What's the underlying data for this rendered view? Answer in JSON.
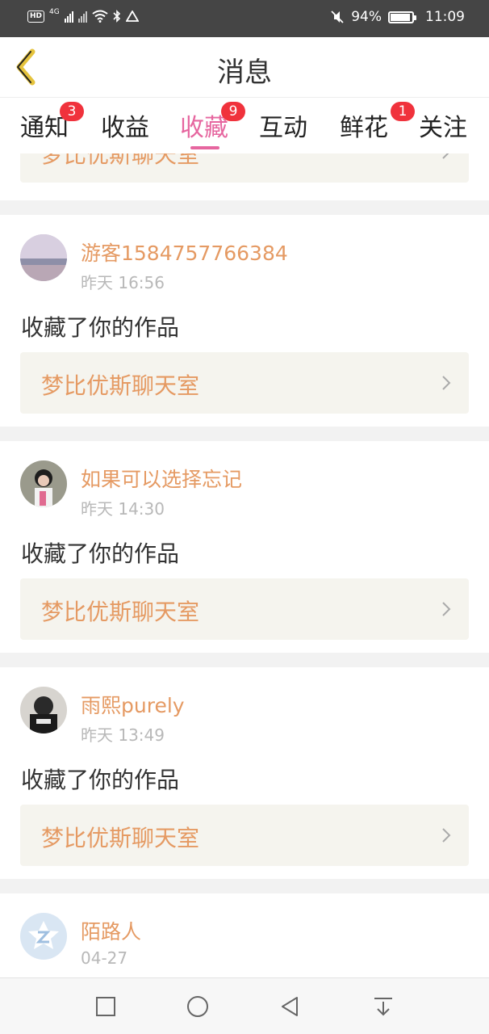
{
  "status_bar": {
    "network": "4G",
    "hd": "HD",
    "battery_percent": "94%",
    "battery_level": 0.94,
    "time": "11:09"
  },
  "header": {
    "title": "消息",
    "back_icon": "back-chevron-icon"
  },
  "tabs": [
    {
      "label": "通知",
      "badge": "3",
      "active": false
    },
    {
      "label": "收益",
      "badge": "",
      "active": false
    },
    {
      "label": "收藏",
      "badge": "9",
      "active": true
    },
    {
      "label": "互动",
      "badge": "",
      "active": false
    },
    {
      "label": "鲜花",
      "badge": "1",
      "active": false
    },
    {
      "label": "关注",
      "badge": "",
      "active": false
    }
  ],
  "feed": {
    "partial_top_work_title": "梦比优斯聊天室",
    "items": [
      {
        "user": "游客1584757766384",
        "time": "昨天 16:56",
        "action": "收藏了你的作品",
        "work_title": "梦比优斯聊天室"
      },
      {
        "user": "如果可以选择忘记",
        "time": "昨天 14:30",
        "action": "收藏了你的作品",
        "work_title": "梦比优斯聊天室"
      },
      {
        "user": "雨熙purely",
        "time": "昨天 13:49",
        "action": "收藏了你的作品",
        "work_title": "梦比优斯聊天室"
      },
      {
        "user": "陌路人",
        "time": "04-27",
        "action": "",
        "work_title": ""
      }
    ]
  },
  "colors": {
    "accent": "#e6669f",
    "username": "#e59a63",
    "badge": "#f0323c",
    "status_bar": "#454545"
  },
  "navbar": {
    "icons": [
      "square-recents-icon",
      "circle-home-icon",
      "triangle-back-icon",
      "pull-down-icon"
    ]
  }
}
